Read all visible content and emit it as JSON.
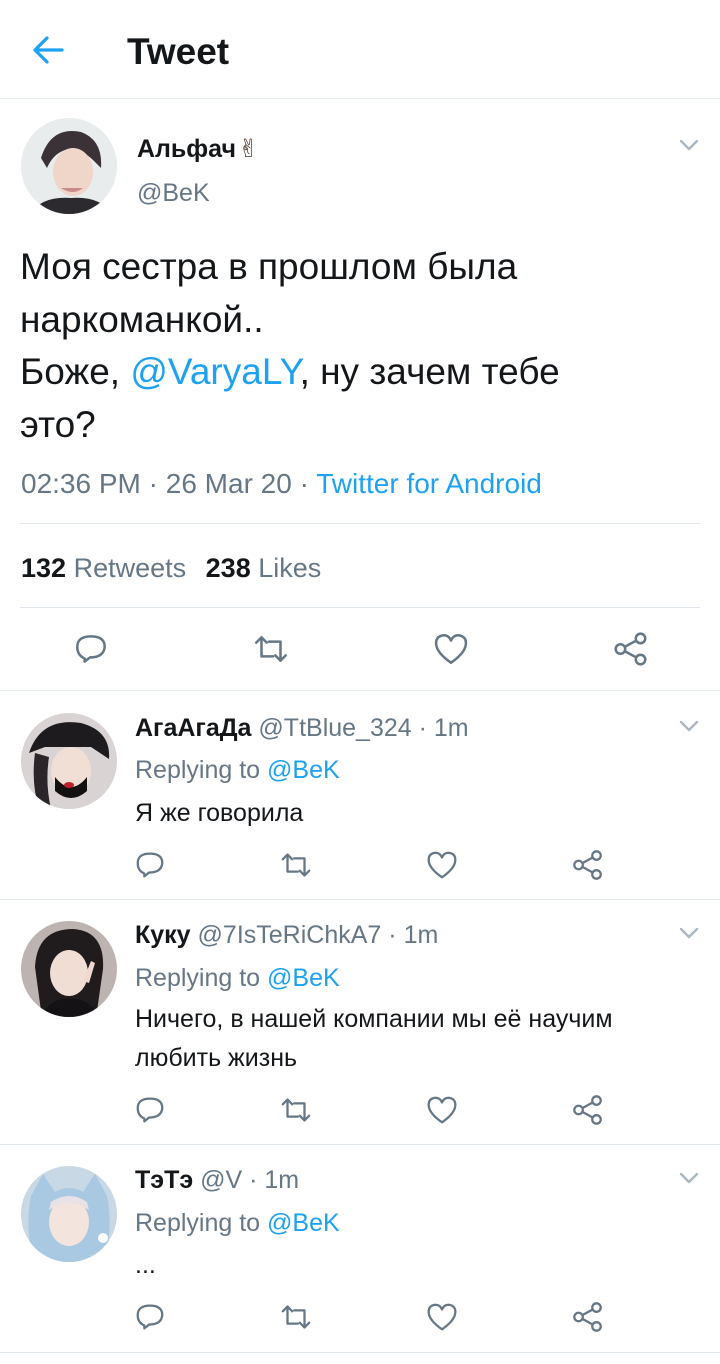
{
  "header": {
    "title": "Tweet"
  },
  "tweet": {
    "author_name": "Альфач",
    "author_emoji": "✌",
    "author_handle": "@BeK",
    "text": {
      "line1": "Моя сестра в прошлом была",
      "line2": "наркоманкой..",
      "line3_pre": "Боже, ",
      "line3_mention": "@VaryaLY",
      "line3_post": ", ну зачем тебе",
      "line4": "это?"
    },
    "time": "02:36 PM",
    "date": "26 Mar 20",
    "source": "Twitter for Android",
    "retweets_count": "132",
    "retweets_label": "Retweets",
    "likes_count": "238",
    "likes_label": "Likes"
  },
  "replies": [
    {
      "name": "АгаАгаДа",
      "handle": "@TtBlue_324",
      "time": "1m",
      "replying_label": "Replying to",
      "replying_to": "@BeK",
      "text_line1": "Я же говорила",
      "text_line2": ""
    },
    {
      "name": "Куку",
      "handle": "@7IsTeRiChkA7",
      "time": "1m",
      "replying_label": "Replying to",
      "replying_to": "@BeK",
      "text_line1": "Ничего, в нашей компании мы её научим",
      "text_line2": "любить жизнь"
    },
    {
      "name": "ТэТэ",
      "handle": "@V",
      "time": "1m",
      "replying_label": "Replying to",
      "replying_to": "@BeK",
      "text_line1": "...",
      "text_line2": ""
    }
  ],
  "separator": "·",
  "colors": {
    "accent": "#1da1f2",
    "secondary": "#657786",
    "divider": "#e1e8ed"
  }
}
